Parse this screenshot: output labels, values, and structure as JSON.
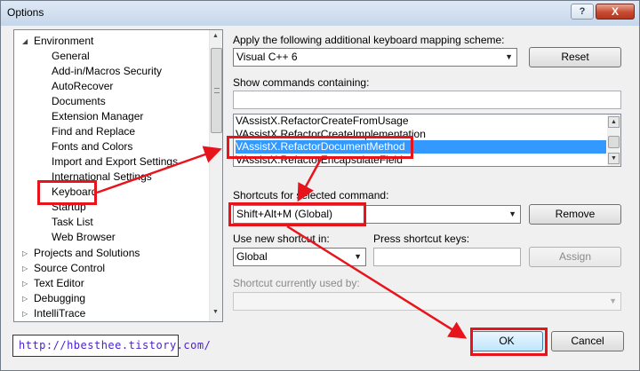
{
  "window": {
    "title": "Options",
    "help_label": "?",
    "close_label": "X"
  },
  "tree": {
    "items": [
      {
        "label": "Environment",
        "expander": "◢"
      },
      {
        "label": "General"
      },
      {
        "label": "Add-in/Macros Security"
      },
      {
        "label": "AutoRecover"
      },
      {
        "label": "Documents"
      },
      {
        "label": "Extension Manager"
      },
      {
        "label": "Find and Replace"
      },
      {
        "label": "Fonts and Colors"
      },
      {
        "label": "Import and Export Settings"
      },
      {
        "label": "International Settings"
      },
      {
        "label": "Keyboard"
      },
      {
        "label": "Startup"
      },
      {
        "label": "Task List"
      },
      {
        "label": "Web Browser"
      },
      {
        "label": "Projects and Solutions",
        "expander": "▷"
      },
      {
        "label": "Source Control",
        "expander": "▷"
      },
      {
        "label": "Text Editor",
        "expander": "▷"
      },
      {
        "label": "Debugging",
        "expander": "▷"
      },
      {
        "label": "IntelliTrace",
        "expander": "▷"
      }
    ],
    "scroll_up": "▲",
    "scroll_down": "▼"
  },
  "mapping": {
    "label": "Apply the following additional keyboard mapping scheme:",
    "value": "Visual C++ 6",
    "reset_label": "Reset"
  },
  "commands": {
    "label": "Show commands containing:",
    "filter_value": "",
    "items": [
      "VAssistX.RefactorCreateFromUsage",
      "VAssistX.RefactorCreateImplementation",
      "VAssistX.RefactorDocumentMethod",
      "VAssistX.RefactorEncapsulateField"
    ],
    "selected_index": 2
  },
  "shortcuts": {
    "label": "Shortcuts for selected command:",
    "value": "Shift+Alt+M (Global)",
    "remove_label": "Remove"
  },
  "new_shortcut": {
    "use_in_label": "Use new shortcut in:",
    "use_in_value": "Global",
    "press_keys_label": "Press shortcut keys:",
    "press_keys_value": "",
    "assign_label": "Assign"
  },
  "current_use": {
    "label": "Shortcut currently used by:",
    "value": ""
  },
  "footer": {
    "ok_label": "OK",
    "cancel_label": "Cancel"
  },
  "watermark": {
    "url": "http://hbesthee.tistory.com/"
  },
  "colors": {
    "annotation_red": "#e8141c",
    "selection_blue": "#3399ff",
    "watermark_text": "#4a22c9"
  }
}
